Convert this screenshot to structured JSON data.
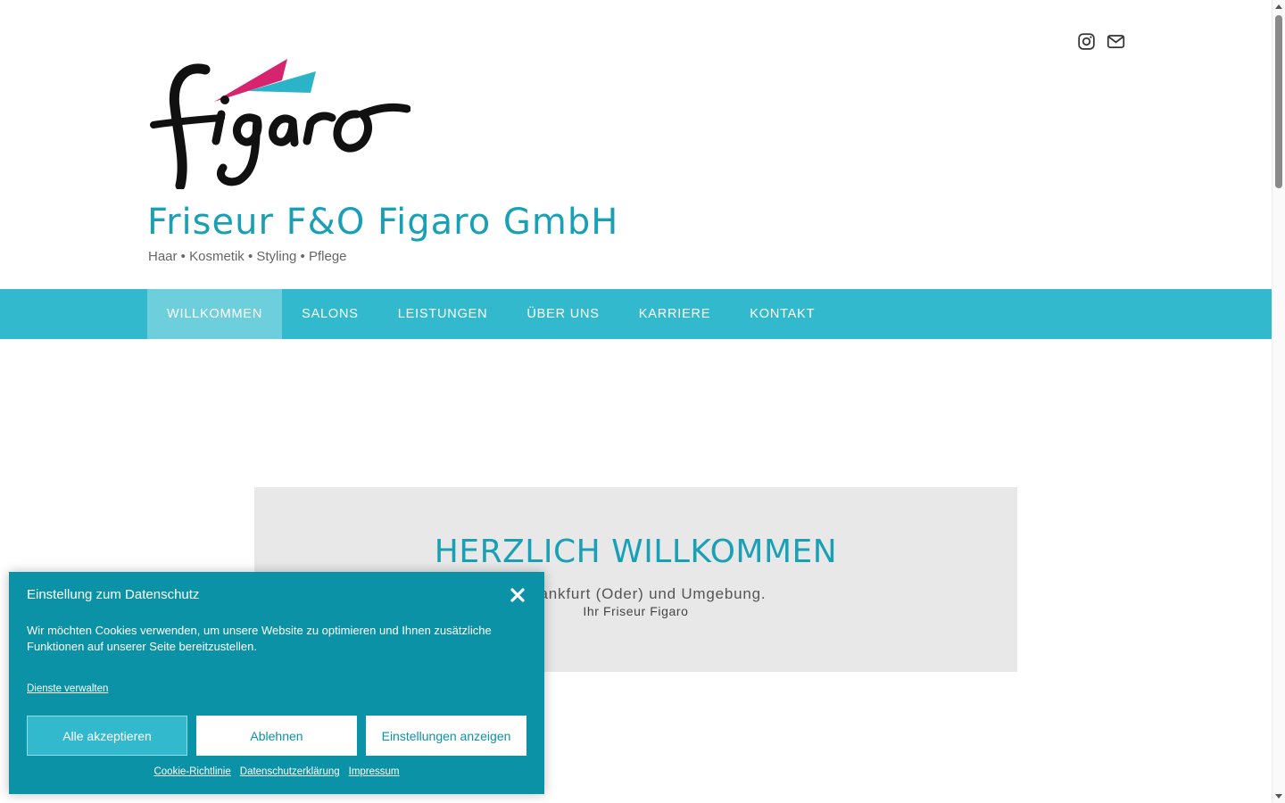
{
  "header": {
    "logo_text": "figaro",
    "site_title": "Friseur F&O Figaro GmbH",
    "tagline": "Haar • Kosmetik • Styling • Pflege",
    "icons": [
      "instagram-icon",
      "mail-icon"
    ]
  },
  "nav": {
    "items": [
      {
        "label": "WILLKOMMEN",
        "active": true
      },
      {
        "label": "SALONS",
        "active": false
      },
      {
        "label": "LEISTUNGEN",
        "active": false
      },
      {
        "label": "ÜBER UNS",
        "active": false
      },
      {
        "label": "KARRIERE",
        "active": false
      },
      {
        "label": "KONTAKT",
        "active": false
      }
    ]
  },
  "welcome": {
    "heading": "HERZLICH WILLKOMMEN",
    "text": "in Frankfurt (Oder) und Umgebung.",
    "sign": "Ihr Friseur Figaro"
  },
  "cookie": {
    "title": "Einstellung zum Datenschutz",
    "text": "Wir möchten Cookies verwenden, um unsere Website zu optimieren und Ihnen zusätzliche Funktionen auf unserer Seite bereitzustellen.",
    "manage": "Dienste verwalten",
    "buttons": {
      "accept": "Alle akzeptieren",
      "deny": "Ablehnen",
      "settings": "Einstellungen anzeigen"
    },
    "links": {
      "cookie_policy": "Cookie-Richtlinie",
      "privacy": "Datenschutzerklärung",
      "imprint": "Impressum"
    }
  },
  "colors": {
    "brand_teal": "#1aa0b4",
    "nav_bg": "#33b9cd",
    "nav_active": "#6ecfdc",
    "cookie_bg": "#0b92a6",
    "welcome_bg": "#e8e8e8",
    "logo_pink": "#d6246e",
    "logo_teal": "#2bb3c7"
  }
}
